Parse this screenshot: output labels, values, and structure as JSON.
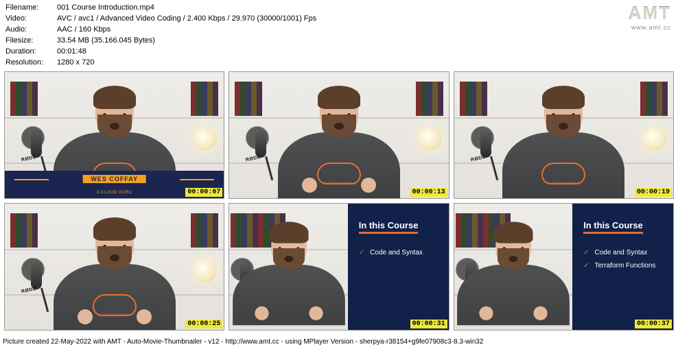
{
  "info": {
    "filename_label": "Filename:",
    "filename": "001 Course Introduction.mp4",
    "video_label": "Video:",
    "video": "AVC / avc1 / Advanced Video Coding / 2.400 Kbps / 29.970 (30000/1001) Fps",
    "audio_label": "Audio:",
    "audio": "AAC / 160 Kbps",
    "filesize_label": "Filesize:",
    "filesize": "33.54 MB (35.166.045 Bytes)",
    "duration_label": "Duration:",
    "duration": "00:01:48",
    "resolution_label": "Resolution:",
    "resolution": "1280 x 720"
  },
  "logo": {
    "big": "AMT",
    "small": "www.amt.cc"
  },
  "presenter": {
    "name": "WES COFFAY",
    "subtitle": "A CLOUD GURU",
    "tshirt": "A CLOUD GURU"
  },
  "mic_brand": "RØDE",
  "course": {
    "title": "In this Course",
    "item1": "Code and Syntax",
    "item2": "Terraform Functions"
  },
  "thumbs": [
    {
      "ts": "00:00:07"
    },
    {
      "ts": "00:00:13"
    },
    {
      "ts": "00:00:19"
    },
    {
      "ts": "00:00:25"
    },
    {
      "ts": "00:00:31"
    },
    {
      "ts": "00:00:37"
    }
  ],
  "footer": "Picture created 22-May-2022 with AMT - Auto-Movie-Thumbnailer - v12 - http://www.amt.cc - using MPlayer Version - sherpya-r38154+g9fe07908c3-8.3-win32"
}
